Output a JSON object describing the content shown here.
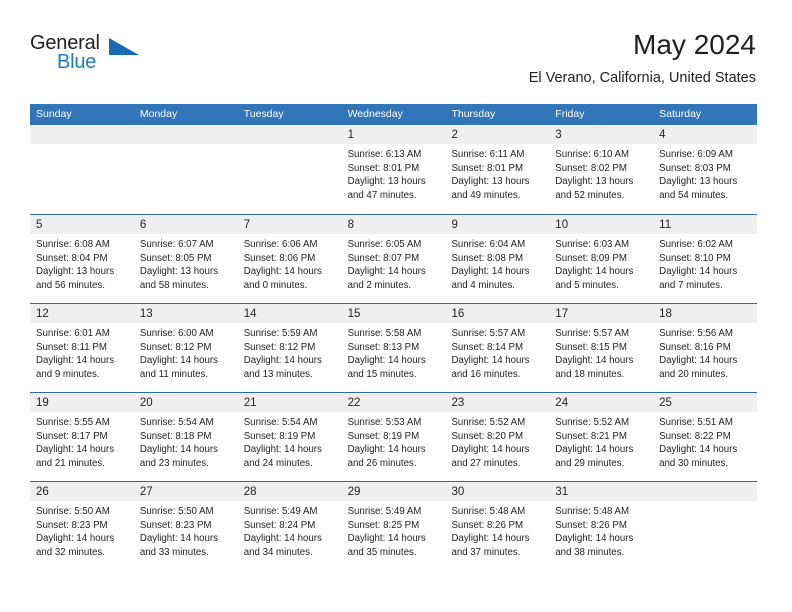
{
  "brand": {
    "name_top": "General",
    "name_bottom": "Blue",
    "color_dark": "#231f20",
    "color_blue": "#1f7cc4",
    "triangle_color": "#1c69b3"
  },
  "header": {
    "title": "May 2024",
    "subtitle": "El Verano, California, United States"
  },
  "theme": {
    "header_bg": "#3275b8",
    "header_text": "#ffffff",
    "row_divider": "#2b6cab",
    "daynum_band": "#efefef",
    "text": "#231f20"
  },
  "weekdays": [
    "Sunday",
    "Monday",
    "Tuesday",
    "Wednesday",
    "Thursday",
    "Friday",
    "Saturday"
  ],
  "labels": {
    "sunrise": "Sunrise:",
    "sunset": "Sunset:",
    "daylight": "Daylight:"
  },
  "weeks": [
    [
      {
        "day": "",
        "sunrise": "",
        "sunset": "",
        "daylight_1": "",
        "daylight_2": ""
      },
      {
        "day": "",
        "sunrise": "",
        "sunset": "",
        "daylight_1": "",
        "daylight_2": ""
      },
      {
        "day": "",
        "sunrise": "",
        "sunset": "",
        "daylight_1": "",
        "daylight_2": ""
      },
      {
        "day": "1",
        "sunrise": "Sunrise: 6:13 AM",
        "sunset": "Sunset: 8:01 PM",
        "daylight_1": "Daylight: 13 hours",
        "daylight_2": "and 47 minutes."
      },
      {
        "day": "2",
        "sunrise": "Sunrise: 6:11 AM",
        "sunset": "Sunset: 8:01 PM",
        "daylight_1": "Daylight: 13 hours",
        "daylight_2": "and 49 minutes."
      },
      {
        "day": "3",
        "sunrise": "Sunrise: 6:10 AM",
        "sunset": "Sunset: 8:02 PM",
        "daylight_1": "Daylight: 13 hours",
        "daylight_2": "and 52 minutes."
      },
      {
        "day": "4",
        "sunrise": "Sunrise: 6:09 AM",
        "sunset": "Sunset: 8:03 PM",
        "daylight_1": "Daylight: 13 hours",
        "daylight_2": "and 54 minutes."
      }
    ],
    [
      {
        "day": "5",
        "sunrise": "Sunrise: 6:08 AM",
        "sunset": "Sunset: 8:04 PM",
        "daylight_1": "Daylight: 13 hours",
        "daylight_2": "and 56 minutes."
      },
      {
        "day": "6",
        "sunrise": "Sunrise: 6:07 AM",
        "sunset": "Sunset: 8:05 PM",
        "daylight_1": "Daylight: 13 hours",
        "daylight_2": "and 58 minutes."
      },
      {
        "day": "7",
        "sunrise": "Sunrise: 6:06 AM",
        "sunset": "Sunset: 8:06 PM",
        "daylight_1": "Daylight: 14 hours",
        "daylight_2": "and 0 minutes."
      },
      {
        "day": "8",
        "sunrise": "Sunrise: 6:05 AM",
        "sunset": "Sunset: 8:07 PM",
        "daylight_1": "Daylight: 14 hours",
        "daylight_2": "and 2 minutes."
      },
      {
        "day": "9",
        "sunrise": "Sunrise: 6:04 AM",
        "sunset": "Sunset: 8:08 PM",
        "daylight_1": "Daylight: 14 hours",
        "daylight_2": "and 4 minutes."
      },
      {
        "day": "10",
        "sunrise": "Sunrise: 6:03 AM",
        "sunset": "Sunset: 8:09 PM",
        "daylight_1": "Daylight: 14 hours",
        "daylight_2": "and 5 minutes."
      },
      {
        "day": "11",
        "sunrise": "Sunrise: 6:02 AM",
        "sunset": "Sunset: 8:10 PM",
        "daylight_1": "Daylight: 14 hours",
        "daylight_2": "and 7 minutes."
      }
    ],
    [
      {
        "day": "12",
        "sunrise": "Sunrise: 6:01 AM",
        "sunset": "Sunset: 8:11 PM",
        "daylight_1": "Daylight: 14 hours",
        "daylight_2": "and 9 minutes."
      },
      {
        "day": "13",
        "sunrise": "Sunrise: 6:00 AM",
        "sunset": "Sunset: 8:12 PM",
        "daylight_1": "Daylight: 14 hours",
        "daylight_2": "and 11 minutes."
      },
      {
        "day": "14",
        "sunrise": "Sunrise: 5:59 AM",
        "sunset": "Sunset: 8:12 PM",
        "daylight_1": "Daylight: 14 hours",
        "daylight_2": "and 13 minutes."
      },
      {
        "day": "15",
        "sunrise": "Sunrise: 5:58 AM",
        "sunset": "Sunset: 8:13 PM",
        "daylight_1": "Daylight: 14 hours",
        "daylight_2": "and 15 minutes."
      },
      {
        "day": "16",
        "sunrise": "Sunrise: 5:57 AM",
        "sunset": "Sunset: 8:14 PM",
        "daylight_1": "Daylight: 14 hours",
        "daylight_2": "and 16 minutes."
      },
      {
        "day": "17",
        "sunrise": "Sunrise: 5:57 AM",
        "sunset": "Sunset: 8:15 PM",
        "daylight_1": "Daylight: 14 hours",
        "daylight_2": "and 18 minutes."
      },
      {
        "day": "18",
        "sunrise": "Sunrise: 5:56 AM",
        "sunset": "Sunset: 8:16 PM",
        "daylight_1": "Daylight: 14 hours",
        "daylight_2": "and 20 minutes."
      }
    ],
    [
      {
        "day": "19",
        "sunrise": "Sunrise: 5:55 AM",
        "sunset": "Sunset: 8:17 PM",
        "daylight_1": "Daylight: 14 hours",
        "daylight_2": "and 21 minutes."
      },
      {
        "day": "20",
        "sunrise": "Sunrise: 5:54 AM",
        "sunset": "Sunset: 8:18 PM",
        "daylight_1": "Daylight: 14 hours",
        "daylight_2": "and 23 minutes."
      },
      {
        "day": "21",
        "sunrise": "Sunrise: 5:54 AM",
        "sunset": "Sunset: 8:19 PM",
        "daylight_1": "Daylight: 14 hours",
        "daylight_2": "and 24 minutes."
      },
      {
        "day": "22",
        "sunrise": "Sunrise: 5:53 AM",
        "sunset": "Sunset: 8:19 PM",
        "daylight_1": "Daylight: 14 hours",
        "daylight_2": "and 26 minutes."
      },
      {
        "day": "23",
        "sunrise": "Sunrise: 5:52 AM",
        "sunset": "Sunset: 8:20 PM",
        "daylight_1": "Daylight: 14 hours",
        "daylight_2": "and 27 minutes."
      },
      {
        "day": "24",
        "sunrise": "Sunrise: 5:52 AM",
        "sunset": "Sunset: 8:21 PM",
        "daylight_1": "Daylight: 14 hours",
        "daylight_2": "and 29 minutes."
      },
      {
        "day": "25",
        "sunrise": "Sunrise: 5:51 AM",
        "sunset": "Sunset: 8:22 PM",
        "daylight_1": "Daylight: 14 hours",
        "daylight_2": "and 30 minutes."
      }
    ],
    [
      {
        "day": "26",
        "sunrise": "Sunrise: 5:50 AM",
        "sunset": "Sunset: 8:23 PM",
        "daylight_1": "Daylight: 14 hours",
        "daylight_2": "and 32 minutes."
      },
      {
        "day": "27",
        "sunrise": "Sunrise: 5:50 AM",
        "sunset": "Sunset: 8:23 PM",
        "daylight_1": "Daylight: 14 hours",
        "daylight_2": "and 33 minutes."
      },
      {
        "day": "28",
        "sunrise": "Sunrise: 5:49 AM",
        "sunset": "Sunset: 8:24 PM",
        "daylight_1": "Daylight: 14 hours",
        "daylight_2": "and 34 minutes."
      },
      {
        "day": "29",
        "sunrise": "Sunrise: 5:49 AM",
        "sunset": "Sunset: 8:25 PM",
        "daylight_1": "Daylight: 14 hours",
        "daylight_2": "and 35 minutes."
      },
      {
        "day": "30",
        "sunrise": "Sunrise: 5:48 AM",
        "sunset": "Sunset: 8:26 PM",
        "daylight_1": "Daylight: 14 hours",
        "daylight_2": "and 37 minutes."
      },
      {
        "day": "31",
        "sunrise": "Sunrise: 5:48 AM",
        "sunset": "Sunset: 8:26 PM",
        "daylight_1": "Daylight: 14 hours",
        "daylight_2": "and 38 minutes."
      },
      {
        "day": "",
        "sunrise": "",
        "sunset": "",
        "daylight_1": "",
        "daylight_2": ""
      }
    ]
  ]
}
